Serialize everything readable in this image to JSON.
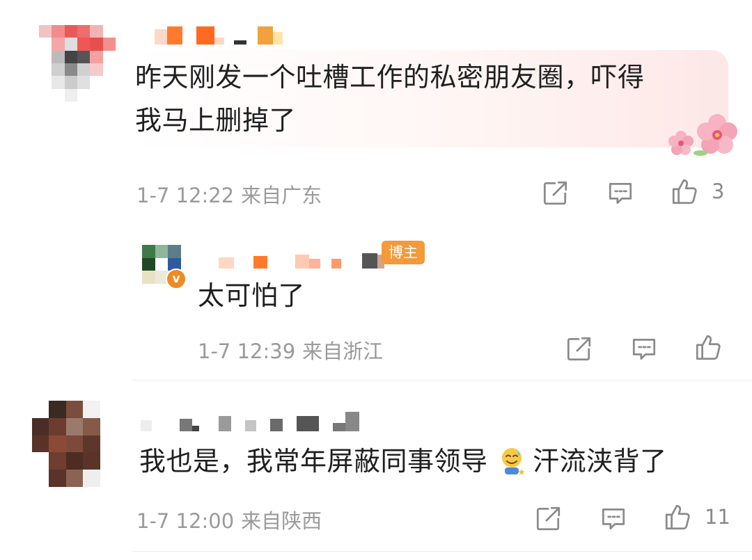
{
  "comments": [
    {
      "text_line1": "昨天刚发一个吐槽工作的私密朋友圈，吓得",
      "text_line2": "我马上删掉了",
      "date": "1-7 12:22",
      "location": "来自广东",
      "likes": "3"
    },
    {
      "text": "太可怕了",
      "badge": "博主",
      "v_mark": "v",
      "date": "1-7 12:39",
      "location": "来自浙江",
      "likes": ""
    },
    {
      "text_before_emoji": "我也是，我常年屏蔽同事领导 ",
      "text_after_emoji": "汗流浃背了",
      "date": "1-7 12:00",
      "location": "来自陕西",
      "likes": "11"
    }
  ],
  "icons": {
    "share": "share-icon",
    "comment": "comment-icon",
    "like": "thumbs-up-icon",
    "emoji": "sweat-smile-emoji-icon",
    "flower": "blossom-decoration-icon"
  },
  "colors": {
    "text": "#1f1f1f",
    "meta": "#9a9a9a",
    "badge": "#f39a3a",
    "icon": "#8a8a8a"
  }
}
